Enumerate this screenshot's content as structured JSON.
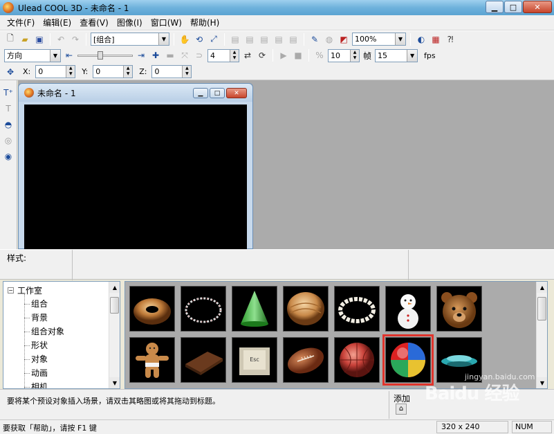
{
  "window": {
    "title": "Ulead COOL 3D - 未命名 - 1"
  },
  "menu": [
    "文件(F)",
    "编辑(E)",
    "查看(V)",
    "图像(I)",
    "窗口(W)",
    "帮助(H)"
  ],
  "toolbar1": {
    "group_select": "[组合]",
    "zoom_select": "100%"
  },
  "toolbar2": {
    "mode_select": "方向",
    "frame_value": "4",
    "fps_value_1": "10",
    "frame_label": "帧",
    "fps_value_2": "15",
    "fps_label": "fps",
    "slider_level": 0.4
  },
  "toolbar3": {
    "x_label": "X:",
    "x_value": "0",
    "y_label": "Y:",
    "y_value": "0",
    "z_label": "Z:",
    "z_value": "0"
  },
  "child_window": {
    "title": "未命名 - 1"
  },
  "style_bar": {
    "label": "样式:"
  },
  "tree": {
    "root": "工作室",
    "items": [
      "组合",
      "背景",
      "组合对象",
      "形状",
      "对象",
      "动画",
      "相机"
    ]
  },
  "thumbnails": {
    "selected_index": 11,
    "items": [
      "donut-thumb",
      "ring-thumb",
      "cone-thumb",
      "bread-thumb",
      "pearl-necklace-thumb",
      "snowman-thumb",
      "bear-head-thumb",
      "gingerbread-thumb",
      "chocolate-bar-thumb",
      "esc-key-thumb",
      "football-thumb",
      "basketball-thumb",
      "beach-ball-thumb",
      "spinning-top-thumb"
    ]
  },
  "hint_bar": {
    "hint": "要将某个预设对象插入场景，请双击其略图或将其拖动到标题。",
    "add_label": "添加"
  },
  "status_bar": {
    "help": "要获取「帮助」，请按 F1 键",
    "resolution": "320 x 240",
    "num": "NUM"
  },
  "watermark": {
    "text": "Baidu 经验",
    "sub": "jingyan.baidu.com"
  }
}
